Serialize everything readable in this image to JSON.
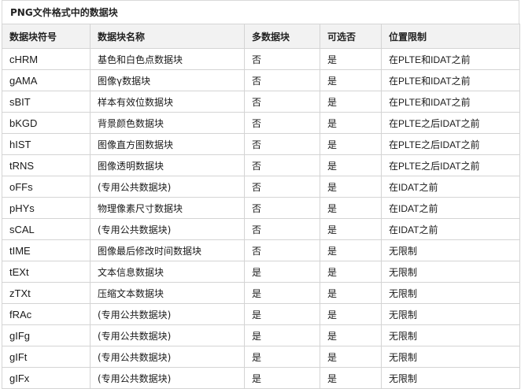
{
  "caption": "PNG文件格式中的数据块",
  "headers": [
    "数据块符号",
    "数据块名称",
    "多数据块",
    "可选否",
    "位置限制"
  ],
  "rows": [
    [
      "cHRM",
      "基色和白色点数据块",
      "否",
      "是",
      "在PLTE和IDAT之前"
    ],
    [
      "gAMA",
      "图像γ数据块",
      "否",
      "是",
      "在PLTE和IDAT之前"
    ],
    [
      "sBIT",
      "样本有效位数据块",
      "否",
      "是",
      "在PLTE和IDAT之前"
    ],
    [
      "bKGD",
      "背景颜色数据块",
      "否",
      "是",
      "在PLTE之后IDAT之前"
    ],
    [
      "hIST",
      "图像直方图数据块",
      "否",
      "是",
      "在PLTE之后IDAT之前"
    ],
    [
      "tRNS",
      "图像透明数据块",
      "否",
      "是",
      "在PLTE之后IDAT之前"
    ],
    [
      "oFFs",
      "(专用公共数据块)",
      "否",
      "是",
      "在IDAT之前"
    ],
    [
      "pHYs",
      "物理像素尺寸数据块",
      "否",
      "是",
      "在IDAT之前"
    ],
    [
      "sCAL",
      "(专用公共数据块)",
      "否",
      "是",
      "在IDAT之前"
    ],
    [
      "tIME",
      "图像最后修改时间数据块",
      "否",
      "是",
      "无限制"
    ],
    [
      "tEXt",
      "文本信息数据块",
      "是",
      "是",
      "无限制"
    ],
    [
      "zTXt",
      "压缩文本数据块",
      "是",
      "是",
      "无限制"
    ],
    [
      "fRAc",
      "(专用公共数据块)",
      "是",
      "是",
      "无限制"
    ],
    [
      "gIFg",
      "(专用公共数据块)",
      "是",
      "是",
      "无限制"
    ],
    [
      "gIFt",
      "(专用公共数据块)",
      "是",
      "是",
      "无限制"
    ],
    [
      "gIFx",
      "(专用公共数据块)",
      "是",
      "是",
      "无限制"
    ]
  ]
}
